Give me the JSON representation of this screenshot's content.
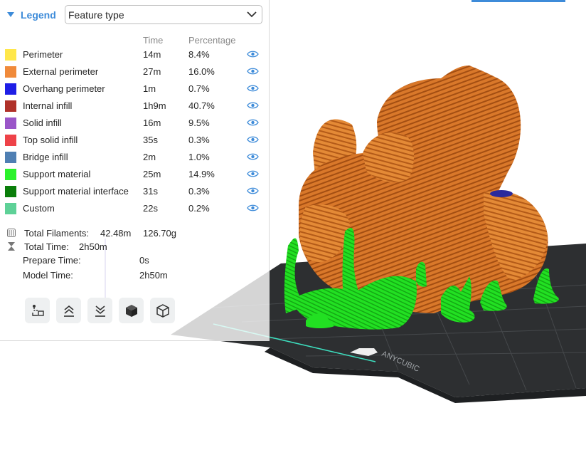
{
  "legend": {
    "title": "Legend",
    "view_mode_value": "Feature type",
    "columns": {
      "time": "Time",
      "percentage": "Percentage"
    },
    "features": [
      {
        "name": "Perimeter",
        "time": "14m",
        "percent": "8.4%",
        "color": "#FFE74A"
      },
      {
        "name": "External perimeter",
        "time": "27m",
        "percent": "16.0%",
        "color": "#F08A3A"
      },
      {
        "name": "Overhang perimeter",
        "time": "1m",
        "percent": "0.7%",
        "color": "#1E1EE6"
      },
      {
        "name": "Internal infill",
        "time": "1h9m",
        "percent": "40.7%",
        "color": "#B03129"
      },
      {
        "name": "Solid infill",
        "time": "16m",
        "percent": "9.5%",
        "color": "#9A55C8"
      },
      {
        "name": "Top solid infill",
        "time": "35s",
        "percent": "0.3%",
        "color": "#EE4248"
      },
      {
        "name": "Bridge infill",
        "time": "2m",
        "percent": "1.0%",
        "color": "#4F7FB3"
      },
      {
        "name": "Support material",
        "time": "25m",
        "percent": "14.9%",
        "color": "#2BF22B"
      },
      {
        "name": "Support material interface",
        "time": "31s",
        "percent": "0.3%",
        "color": "#0A7E0A"
      },
      {
        "name": "Custom",
        "time": "22s",
        "percent": "0.2%",
        "color": "#5ED197"
      }
    ]
  },
  "stats": {
    "total_filaments_label": "Total Filaments:",
    "total_filaments_length": "42.48m",
    "total_filaments_weight": "126.70g",
    "total_time_label": "Total Time:",
    "total_time_value": "2h50m",
    "prepare_time_label": "Prepare Time:",
    "prepare_time_value": "0s",
    "model_time_label": "Model Time:",
    "model_time_value": "2h50m"
  },
  "bed": {
    "brand_text": "ANYCUBIC"
  },
  "colors": {
    "accent": "#3D8BD9",
    "model_orange": "#D97A2B",
    "support_green": "#22E022",
    "bed_dark": "#2D2F31"
  },
  "icons": {
    "collapse": "triangle-down-icon",
    "dropdown": "chevron-down-icon",
    "visibility": "eye-icon",
    "filament": "filament-spool-icon",
    "time": "hourglass-icon",
    "toolbar": [
      "layer-path-icon",
      "move-layer-up-icon",
      "move-layer-down-icon",
      "solid-cube-icon",
      "wireframe-cube-icon"
    ]
  }
}
